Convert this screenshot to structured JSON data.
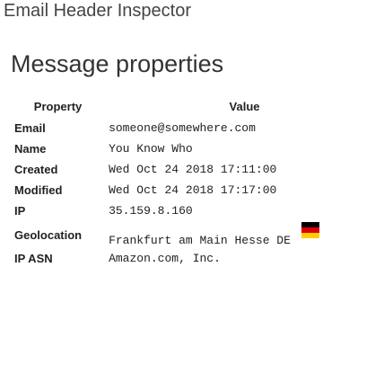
{
  "app": {
    "title": "Email Header Inspector"
  },
  "section": {
    "title": "Message properties"
  },
  "table": {
    "headers": {
      "property": "Property",
      "value": "Value"
    },
    "rows": [
      {
        "property": "Email",
        "value": "someone@somewhere.com"
      },
      {
        "property": "Name",
        "value": "You Know Who"
      },
      {
        "property": "Created",
        "value": "Wed Oct 24 2018 17:11:00"
      },
      {
        "property": "Modified",
        "value": "Wed Oct 24 2018 17:17:00"
      },
      {
        "property": "IP",
        "value": "35.159.8.160"
      },
      {
        "property": "Geolocation",
        "value": "Frankfurt am Main Hesse DE",
        "flag_icon": "germany-flag-icon"
      },
      {
        "property": "IP ASN",
        "value": "Amazon.com, Inc."
      }
    ]
  },
  "colors": {
    "flag_black": "#000000",
    "flag_red": "#dd0000",
    "flag_gold": "#ffce00"
  }
}
